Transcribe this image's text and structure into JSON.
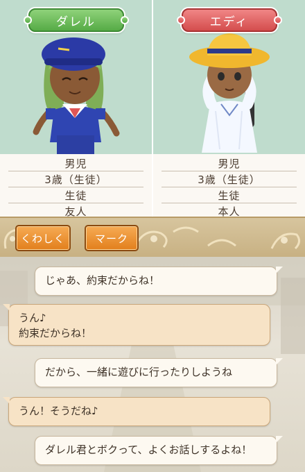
{
  "left_profile": {
    "name": "ダレル",
    "rows": [
      "男児",
      "3歳（生徒）",
      "生徒",
      "友人"
    ]
  },
  "right_profile": {
    "name": "エディ",
    "rows": [
      "男児",
      "3歳（生徒）",
      "生徒",
      "本人"
    ]
  },
  "buttons": {
    "details": "くわしく",
    "mark": "マーク"
  },
  "colors": {
    "left_tag": "#56ab46",
    "right_tag": "#d44d4d",
    "button": "#e27f1c"
  },
  "messages": [
    {
      "speaker": "self",
      "lines": [
        "じゃあ、約束だからね！"
      ]
    },
    {
      "speaker": "other",
      "lines": [
        "うん♪",
        "約束だからね！"
      ]
    },
    {
      "speaker": "self",
      "lines": [
        "だから、一緒に遊びに行ったりしようね"
      ]
    },
    {
      "speaker": "other",
      "lines": [
        "うん！そうだね♪"
      ]
    },
    {
      "speaker": "self",
      "lines": [
        "ダレル君とボクって、よくお話しするよね！"
      ]
    }
  ]
}
